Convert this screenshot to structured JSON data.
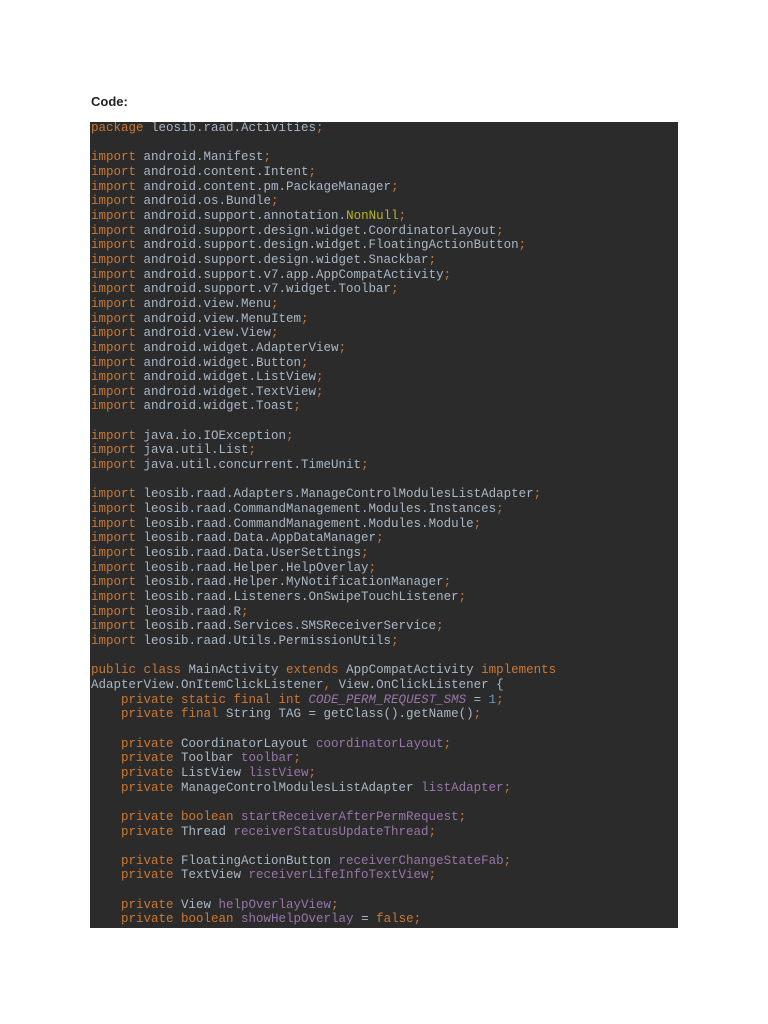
{
  "heading": "Code:",
  "colors": {
    "background": "#2b2b2b",
    "keyword": "#cc7832",
    "text": "#a9b7c6",
    "field": "#9876aa",
    "number": "#6897bb",
    "annotation": "#bbb529"
  },
  "code_lines": [
    [
      [
        "package",
        "k"
      ],
      [
        " leosib.raad.Activities",
        "t"
      ],
      [
        ";",
        "k"
      ]
    ],
    [],
    [
      [
        "import",
        "k"
      ],
      [
        " android.Manifest",
        "t"
      ],
      [
        ";",
        "k"
      ]
    ],
    [
      [
        "import",
        "k"
      ],
      [
        " android.content.Intent",
        "t"
      ],
      [
        ";",
        "k"
      ]
    ],
    [
      [
        "import",
        "k"
      ],
      [
        " android.content.pm.PackageManager",
        "t"
      ],
      [
        ";",
        "k"
      ]
    ],
    [
      [
        "import",
        "k"
      ],
      [
        " android.os.Bundle",
        "t"
      ],
      [
        ";",
        "k"
      ]
    ],
    [
      [
        "import",
        "k"
      ],
      [
        " android.support.annotation.",
        "t"
      ],
      [
        "NonNull",
        "a"
      ],
      [
        ";",
        "k"
      ]
    ],
    [
      [
        "import",
        "k"
      ],
      [
        " android.support.design.widget.CoordinatorLayout",
        "t"
      ],
      [
        ";",
        "k"
      ]
    ],
    [
      [
        "import",
        "k"
      ],
      [
        " android.support.design.widget.FloatingActionButton",
        "t"
      ],
      [
        ";",
        "k"
      ]
    ],
    [
      [
        "import",
        "k"
      ],
      [
        " android.support.design.widget.Snackbar",
        "t"
      ],
      [
        ";",
        "k"
      ]
    ],
    [
      [
        "import",
        "k"
      ],
      [
        " android.support.v7.app.AppCompatActivity",
        "t"
      ],
      [
        ";",
        "k"
      ]
    ],
    [
      [
        "import",
        "k"
      ],
      [
        " android.support.v7.widget.Toolbar",
        "t"
      ],
      [
        ";",
        "k"
      ]
    ],
    [
      [
        "import",
        "k"
      ],
      [
        " android.view.Menu",
        "t"
      ],
      [
        ";",
        "k"
      ]
    ],
    [
      [
        "import",
        "k"
      ],
      [
        " android.view.MenuItem",
        "t"
      ],
      [
        ";",
        "k"
      ]
    ],
    [
      [
        "import",
        "k"
      ],
      [
        " android.view.View",
        "t"
      ],
      [
        ";",
        "k"
      ]
    ],
    [
      [
        "import",
        "k"
      ],
      [
        " android.widget.AdapterView",
        "t"
      ],
      [
        ";",
        "k"
      ]
    ],
    [
      [
        "import",
        "k"
      ],
      [
        " android.widget.Button",
        "t"
      ],
      [
        ";",
        "k"
      ]
    ],
    [
      [
        "import",
        "k"
      ],
      [
        " android.widget.ListView",
        "t"
      ],
      [
        ";",
        "k"
      ]
    ],
    [
      [
        "import",
        "k"
      ],
      [
        " android.widget.TextView",
        "t"
      ],
      [
        ";",
        "k"
      ]
    ],
    [
      [
        "import",
        "k"
      ],
      [
        " android.widget.Toast",
        "t"
      ],
      [
        ";",
        "k"
      ]
    ],
    [],
    [
      [
        "import",
        "k"
      ],
      [
        " java.io.IOException",
        "t"
      ],
      [
        ";",
        "k"
      ]
    ],
    [
      [
        "import",
        "k"
      ],
      [
        " java.util.List",
        "t"
      ],
      [
        ";",
        "k"
      ]
    ],
    [
      [
        "import",
        "k"
      ],
      [
        " java.util.concurrent.TimeUnit",
        "t"
      ],
      [
        ";",
        "k"
      ]
    ],
    [],
    [
      [
        "import",
        "k"
      ],
      [
        " leosib.raad.Adapters.ManageControlModulesListAdapter",
        "t"
      ],
      [
        ";",
        "k"
      ]
    ],
    [
      [
        "import",
        "k"
      ],
      [
        " leosib.raad.CommandManagement.Modules.Instances",
        "t"
      ],
      [
        ";",
        "k"
      ]
    ],
    [
      [
        "import",
        "k"
      ],
      [
        " leosib.raad.CommandManagement.Modules.Module",
        "t"
      ],
      [
        ";",
        "k"
      ]
    ],
    [
      [
        "import",
        "k"
      ],
      [
        " leosib.raad.Data.AppDataManager",
        "t"
      ],
      [
        ";",
        "k"
      ]
    ],
    [
      [
        "import",
        "k"
      ],
      [
        " leosib.raad.Data.UserSettings",
        "t"
      ],
      [
        ";",
        "k"
      ]
    ],
    [
      [
        "import",
        "k"
      ],
      [
        " leosib.raad.Helper.HelpOverlay",
        "t"
      ],
      [
        ";",
        "k"
      ]
    ],
    [
      [
        "import",
        "k"
      ],
      [
        " leosib.raad.Helper.MyNotificationManager",
        "t"
      ],
      [
        ";",
        "k"
      ]
    ],
    [
      [
        "import",
        "k"
      ],
      [
        " leosib.raad.Listeners.OnSwipeTouchListener",
        "t"
      ],
      [
        ";",
        "k"
      ]
    ],
    [
      [
        "import",
        "k"
      ],
      [
        " leosib.raad.R",
        "t"
      ],
      [
        ";",
        "k"
      ]
    ],
    [
      [
        "import",
        "k"
      ],
      [
        " leosib.raad.Services.SMSReceiverService",
        "t"
      ],
      [
        ";",
        "k"
      ]
    ],
    [
      [
        "import",
        "k"
      ],
      [
        " leosib.raad.Utils.PermissionUtils",
        "t"
      ],
      [
        ";",
        "k"
      ]
    ],
    [],
    [
      [
        "public class",
        "k"
      ],
      [
        " MainActivity ",
        "t"
      ],
      [
        "extends",
        "k"
      ],
      [
        " AppCompatActivity ",
        "t"
      ],
      [
        "implements",
        "k"
      ]
    ],
    [
      [
        "AdapterView.OnItemClickListener",
        "t"
      ],
      [
        ",",
        "k"
      ],
      [
        " View.OnClickListener {",
        "t"
      ]
    ],
    [
      [
        "    private static final int ",
        "k"
      ],
      [
        "CODE_PERM_REQUEST_SMS",
        "c"
      ],
      [
        " = ",
        "t"
      ],
      [
        "1",
        "n"
      ],
      [
        ";",
        "k"
      ]
    ],
    [
      [
        "    private final ",
        "k"
      ],
      [
        "String TAG = getClass().getName()",
        "t"
      ],
      [
        ";",
        "k"
      ]
    ],
    [],
    [
      [
        "    private ",
        "k"
      ],
      [
        "CoordinatorLayout ",
        "t"
      ],
      [
        "coordinatorLayout",
        "p"
      ],
      [
        ";",
        "k"
      ]
    ],
    [
      [
        "    private ",
        "k"
      ],
      [
        "Toolbar ",
        "t"
      ],
      [
        "toolbar",
        "p"
      ],
      [
        ";",
        "k"
      ]
    ],
    [
      [
        "    private ",
        "k"
      ],
      [
        "ListView ",
        "t"
      ],
      [
        "listView",
        "p"
      ],
      [
        ";",
        "k"
      ]
    ],
    [
      [
        "    private ",
        "k"
      ],
      [
        "ManageControlModulesListAdapter ",
        "t"
      ],
      [
        "listAdapter",
        "p"
      ],
      [
        ";",
        "k"
      ]
    ],
    [],
    [
      [
        "    private boolean ",
        "k"
      ],
      [
        "startReceiverAfterPermRequest",
        "p"
      ],
      [
        ";",
        "k"
      ]
    ],
    [
      [
        "    private ",
        "k"
      ],
      [
        "Thread ",
        "t"
      ],
      [
        "receiverStatusUpdateThread",
        "p"
      ],
      [
        ";",
        "k"
      ]
    ],
    [],
    [
      [
        "    private ",
        "k"
      ],
      [
        "FloatingActionButton ",
        "t"
      ],
      [
        "receiverChangeStateFab",
        "p"
      ],
      [
        ";",
        "k"
      ]
    ],
    [
      [
        "    private ",
        "k"
      ],
      [
        "TextView ",
        "t"
      ],
      [
        "receiverLifeInfoTextView",
        "p"
      ],
      [
        ";",
        "k"
      ]
    ],
    [],
    [
      [
        "    private ",
        "k"
      ],
      [
        "View ",
        "t"
      ],
      [
        "helpOverlayView",
        "p"
      ],
      [
        ";",
        "k"
      ]
    ],
    [
      [
        "    private boolean ",
        "k"
      ],
      [
        "showHelpOverlay",
        "p"
      ],
      [
        " = ",
        "t"
      ],
      [
        "false;",
        "k"
      ]
    ]
  ]
}
